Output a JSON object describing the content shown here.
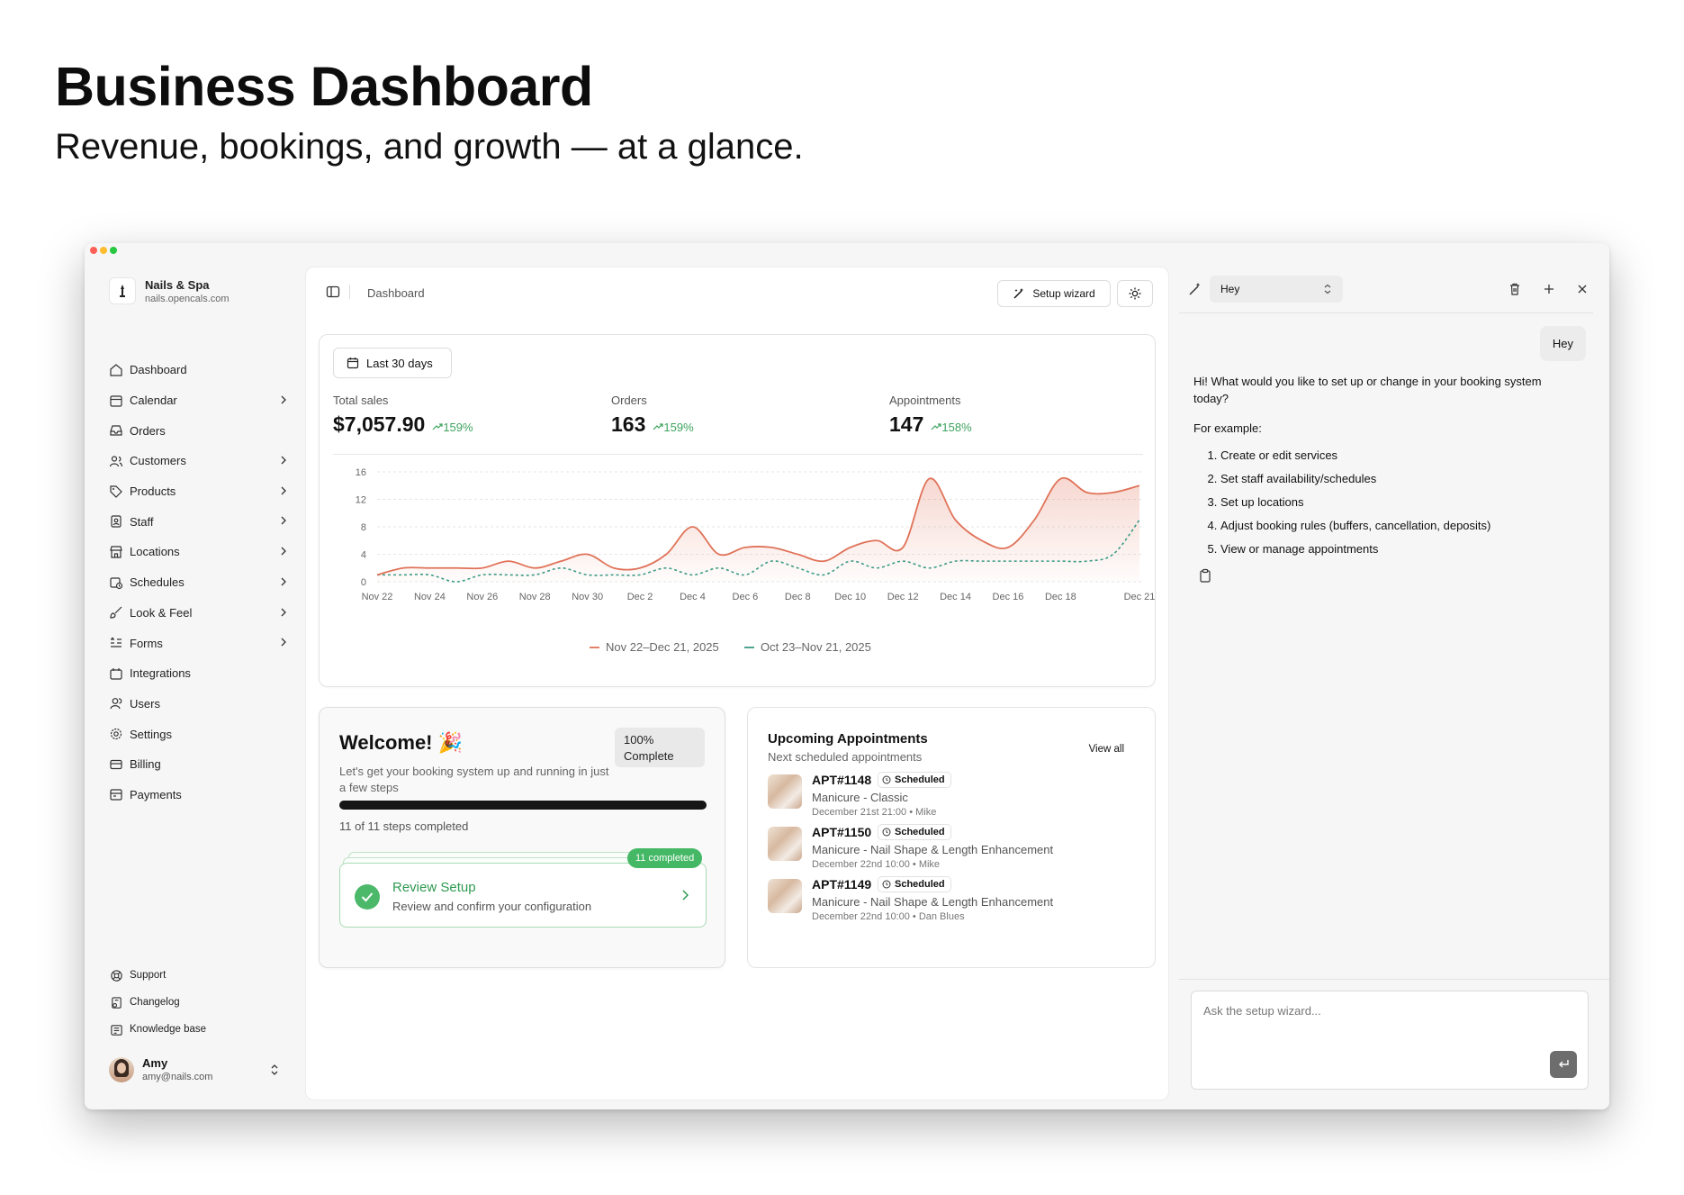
{
  "hero": {
    "title": "Business Dashboard",
    "subtitle": "Revenue, bookings, and growth — at a glance."
  },
  "brand": {
    "name": "Nails & Spa",
    "url": "nails.opencals.com"
  },
  "nav": [
    {
      "label": "Dashboard",
      "icon": "home-icon",
      "chevron": false
    },
    {
      "label": "Calendar",
      "icon": "calendar-icon",
      "chevron": true
    },
    {
      "label": "Orders",
      "icon": "inbox-icon",
      "chevron": false
    },
    {
      "label": "Customers",
      "icon": "users-icon",
      "chevron": true
    },
    {
      "label": "Products",
      "icon": "tag-icon",
      "chevron": true
    },
    {
      "label": "Staff",
      "icon": "badge-icon",
      "chevron": true
    },
    {
      "label": "Locations",
      "icon": "store-icon",
      "chevron": true
    },
    {
      "label": "Schedules",
      "icon": "calendar-clock-icon",
      "chevron": true
    },
    {
      "label": "Look & Feel",
      "icon": "brush-icon",
      "chevron": true
    },
    {
      "label": "Forms",
      "icon": "list-icon",
      "chevron": true
    },
    {
      "label": "Integrations",
      "icon": "plug-icon",
      "chevron": false
    },
    {
      "label": "Users",
      "icon": "user-icon",
      "chevron": false
    },
    {
      "label": "Settings",
      "icon": "gear-icon",
      "chevron": false
    },
    {
      "label": "Billing",
      "icon": "credit-card-icon",
      "chevron": false
    },
    {
      "label": "Payments",
      "icon": "wallet-icon",
      "chevron": false
    }
  ],
  "footer_nav": [
    {
      "label": "Support",
      "icon": "lifebuoy-icon"
    },
    {
      "label": "Changelog",
      "icon": "doc-icon"
    },
    {
      "label": "Knowledge base",
      "icon": "book-icon"
    }
  ],
  "user": {
    "name": "Amy",
    "email": "amy@nails.com"
  },
  "topbar": {
    "breadcrumb": "Dashboard",
    "setup_wizard": "Setup wizard"
  },
  "stats": {
    "range": "Last 30 days",
    "items": [
      {
        "label": "Total sales",
        "value": "$7,057.90",
        "change": "159%"
      },
      {
        "label": "Orders",
        "value": "163",
        "change": "159%"
      },
      {
        "label": "Appointments",
        "value": "147",
        "change": "158%"
      }
    ]
  },
  "chart_data": {
    "type": "area",
    "x_ticks": [
      "Nov 22",
      "Nov 24",
      "Nov 26",
      "Nov 28",
      "Nov 30",
      "Dec 2",
      "Dec 4",
      "Dec 6",
      "Dec 8",
      "Dec 10",
      "Dec 12",
      "Dec 14",
      "Dec 16",
      "Dec 18",
      "Dec 21"
    ],
    "y_ticks": [
      0,
      4,
      8,
      12,
      16
    ],
    "ylim": [
      0,
      16
    ],
    "grid": true,
    "legend_position": "bottom",
    "series": [
      {
        "name": "Nov 22–Dec 21, 2025",
        "color": "#e07258",
        "x": [
          "Nov 22",
          "Nov 23",
          "Nov 24",
          "Nov 25",
          "Nov 26",
          "Nov 27",
          "Nov 28",
          "Nov 29",
          "Nov 30",
          "Dec 1",
          "Dec 2",
          "Dec 3",
          "Dec 4",
          "Dec 5",
          "Dec 6",
          "Dec 7",
          "Dec 8",
          "Dec 9",
          "Dec 10",
          "Dec 11",
          "Dec 12",
          "Dec 13",
          "Dec 14",
          "Dec 15",
          "Dec 16",
          "Dec 17",
          "Dec 18",
          "Dec 19",
          "Dec 20",
          "Dec 21"
        ],
        "values": [
          1,
          2,
          2,
          2,
          2,
          3,
          2,
          3,
          4,
          2,
          2,
          4,
          8,
          4,
          5,
          5,
          4,
          3,
          5,
          6,
          5,
          15,
          9,
          6,
          5,
          9,
          15,
          13,
          13,
          14
        ]
      },
      {
        "name": "Oct 23–Nov 21, 2025",
        "color": "#3b9b86",
        "x": [
          "Nov 22",
          "Nov 23",
          "Nov 24",
          "Nov 25",
          "Nov 26",
          "Nov 27",
          "Nov 28",
          "Nov 29",
          "Nov 30",
          "Dec 1",
          "Dec 2",
          "Dec 3",
          "Dec 4",
          "Dec 5",
          "Dec 6",
          "Dec 7",
          "Dec 8",
          "Dec 9",
          "Dec 10",
          "Dec 11",
          "Dec 12",
          "Dec 13",
          "Dec 14",
          "Dec 15",
          "Dec 16",
          "Dec 17",
          "Dec 18",
          "Dec 19",
          "Dec 20",
          "Dec 21"
        ],
        "values": [
          1,
          1,
          1,
          0,
          1,
          1,
          1,
          2,
          1,
          1,
          1,
          2,
          1,
          2,
          1,
          3,
          2,
          1,
          3,
          2,
          3,
          2,
          3,
          3,
          3,
          3,
          3,
          3,
          4,
          9
        ]
      }
    ]
  },
  "welcome": {
    "title": "Welcome! 🎉",
    "badge_line1": "100%",
    "badge_line2": "Complete",
    "progress": 1.0,
    "subtitle": "Let's get your booking system up and running in just a few steps",
    "steps": "11 of 11 steps completed",
    "completed_pill": "11 completed",
    "review_title": "Review Setup",
    "review_sub": "Review and confirm your configuration"
  },
  "appointments": {
    "title": "Upcoming Appointments",
    "subtitle": "Next scheduled appointments",
    "view_all": "View all",
    "items": [
      {
        "id": "APT#1148",
        "status": "Scheduled",
        "service": "Manicure - Classic",
        "when": "December 21st 21:00 • Mike"
      },
      {
        "id": "APT#1150",
        "status": "Scheduled",
        "service": "Manicure - Nail Shape & Length Enhancement",
        "when": "December 22nd 10:00 • Mike"
      },
      {
        "id": "APT#1149",
        "status": "Scheduled",
        "service": "Manicure - Nail Shape & Length Enhancement",
        "when": "December 22nd 10:00 • Dan Blues"
      }
    ]
  },
  "chat": {
    "thread": "Hey",
    "user_message": "Hey",
    "assistant_intro": "Hi! What would you like to set up or change in your booking system today?",
    "for_example": "For example:",
    "options": [
      "Create or edit services",
      "Set staff availability/schedules",
      "Set up locations",
      "Adjust booking rules (buffers, cancellation, deposits)",
      "View or manage appointments"
    ],
    "placeholder": "Ask the setup wizard..."
  }
}
